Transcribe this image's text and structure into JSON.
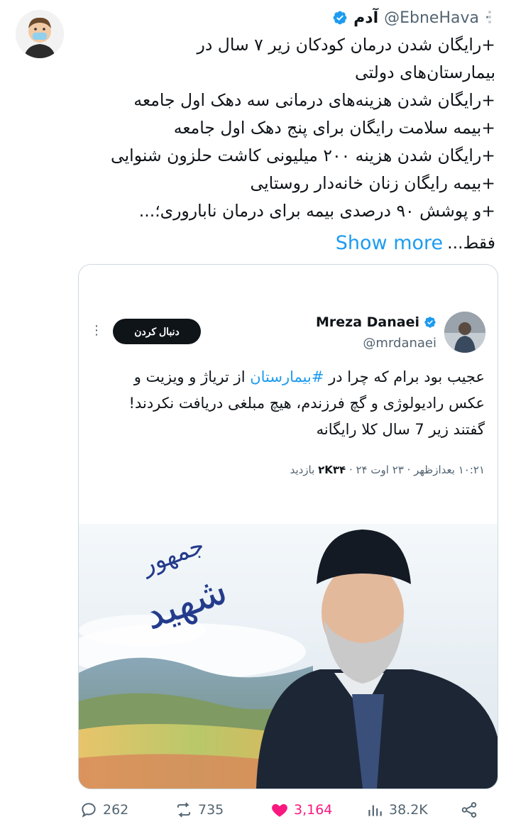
{
  "author": {
    "name": "آدم",
    "handle": "@EbneHava",
    "dot": "·"
  },
  "tweet": {
    "lines": [
      "+رایگان شدن درمان کودکان زیر ۷ سال در",
      "بیمارستان‌های دولتی",
      "+رایگان شدن هزینه‌های درمانی سه دهک اول جامعه",
      "+بیمه سلامت رایگان برای پنج دهک اول جامعه",
      "+رایگان شدن هزینه ۲۰۰ میلیونی کاشت حلزون شنوایی",
      "+بیمه رایگان زنان خانه‌دار روستایی",
      "+و پوشش ۹۰ درصدی بیمه برای درمان ناباروری؛..."
    ],
    "last_line": "فقط...",
    "show_more": "Show more"
  },
  "quote": {
    "name": "Mreza Danaei",
    "handle": "@mrdanaei",
    "follow_label": "دنبال کردن",
    "more_label": "⋮",
    "text_line1_prefix": "عجیب بود برام که چرا در ",
    "text_hashtag": "#بیمارستان",
    "text_line1_suffix": " از تریاژ و ویزیت و",
    "text_line2": "عکس رادیولوژی و گچ فرزندم، هیچ مبلغی دریافت نکردند!",
    "text_line3": "گفتند زیر 7 سال کلا رایگانه",
    "meta_time": "۱۰:۲۱ بعدازظهر · ۲۳ اوت ۲۴ · ",
    "meta_views_count": "۲K۳۴",
    "meta_views_label": " بازدید",
    "banner_calligraphy_1": "شهید",
    "banner_calligraphy_2": "جمهور"
  },
  "actions": {
    "replies": "262",
    "reposts": "735",
    "likes": "3,164",
    "views": "38.2K"
  },
  "colors": {
    "accent": "#1d9bf0",
    "like": "#f91880",
    "text": "#0f1419",
    "muted": "#536471"
  }
}
